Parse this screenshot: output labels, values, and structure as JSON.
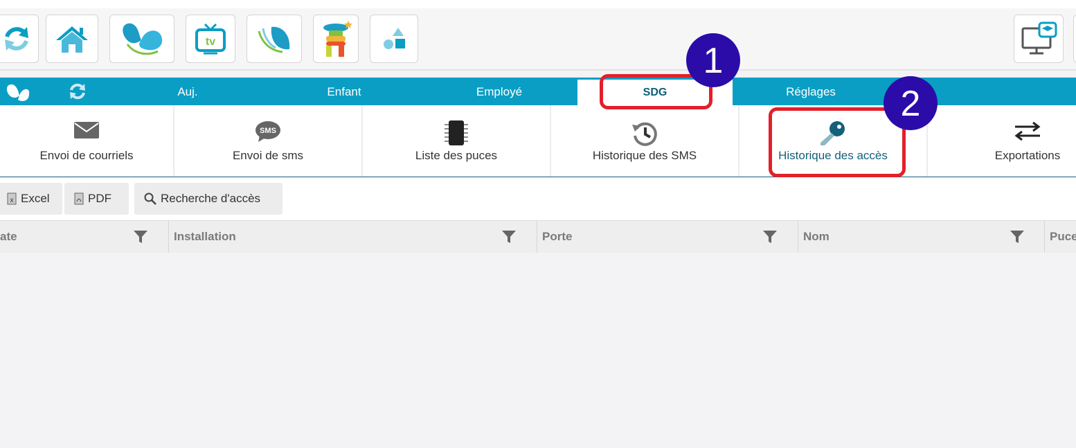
{
  "tabs": [
    {
      "label": "Auj.",
      "active": false
    },
    {
      "label": "Enfant",
      "active": false
    },
    {
      "label": "Employé",
      "active": false
    },
    {
      "label": "SDG",
      "active": true
    },
    {
      "label": "Réglages",
      "active": false
    }
  ],
  "subnav": [
    {
      "label": "Envoi de courriels",
      "icon": "envelope-icon"
    },
    {
      "label": "Envoi de sms",
      "icon": "sms-bubble-icon",
      "icon_text": "SMS"
    },
    {
      "label": "Liste des puces",
      "icon": "chip-icon"
    },
    {
      "label": "Historique des SMS",
      "icon": "history-icon"
    },
    {
      "label": "Historique des accès",
      "icon": "key-icon",
      "active": true
    },
    {
      "label": "Exportations",
      "icon": "swap-arrows-icon"
    }
  ],
  "actions": {
    "excel": "Excel",
    "pdf": "PDF",
    "search": "Recherche d'accès"
  },
  "table": {
    "columns": [
      "ate",
      "Installation",
      "Porte",
      "Nom",
      "Puce"
    ]
  },
  "annotations": {
    "badge1": "1",
    "badge2": "2"
  },
  "colors": {
    "tab_bar": "#0a9ec4",
    "active_text": "#13607a",
    "highlight": "#e2202b",
    "badge": "#2b0ca8"
  }
}
